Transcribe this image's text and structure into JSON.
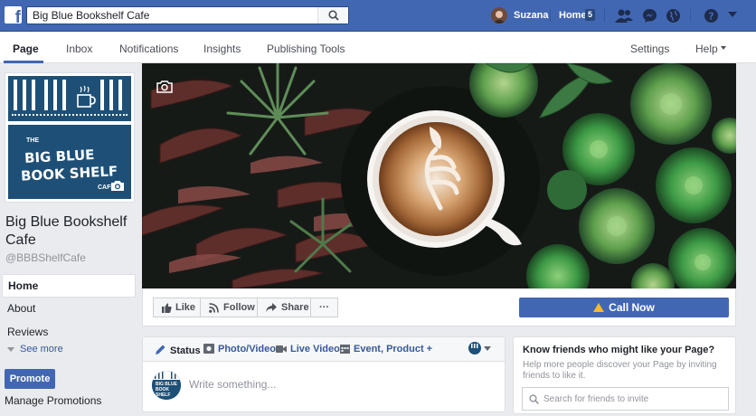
{
  "topbar": {
    "search_value": "Big Blue Bookshelf Cafe",
    "user_name": "Suzana",
    "home_label": "Home",
    "home_count": "5"
  },
  "subnav": {
    "tabs": [
      {
        "label": "Page",
        "active": true
      },
      {
        "label": "Inbox"
      },
      {
        "label": "Notifications"
      },
      {
        "label": "Insights"
      },
      {
        "label": "Publishing Tools"
      }
    ],
    "settings_label": "Settings",
    "help_label": "Help"
  },
  "profile": {
    "logo_the": "THE",
    "logo_line1": "BIG BLUE",
    "logo_line2": "BOOK SHELF",
    "logo_cafe": "CAFE",
    "page_name": "Big Blue Bookshelf Cafe",
    "handle": "@BBBShelfCafe"
  },
  "leftnav": {
    "items": [
      {
        "label": "Home",
        "active": true
      },
      {
        "label": "About"
      },
      {
        "label": "Reviews"
      }
    ],
    "see_more": "See more",
    "promote_label": "Promote",
    "manage_promotions": "Manage Promotions"
  },
  "actions": {
    "like": "Like",
    "follow": "Follow",
    "share": "Share",
    "more": "···",
    "call_now": "Call Now"
  },
  "composer": {
    "tabs": [
      "Status",
      "Photo/Video",
      "Live Video",
      "Event, Product +"
    ],
    "placeholder": "Write something...",
    "avatar_text": "BIG BLUE BOOK SHELF"
  },
  "invite": {
    "title": "Know friends who might like your Page?",
    "description": "Help more people discover your Page by inviting friends to like it.",
    "search_placeholder": "Search for friends to invite"
  },
  "colors": {
    "brand_blue": "#4267b2",
    "logo_navy": "#1e5077",
    "warning": "#f7b928"
  },
  "icons": [
    "facebook-logo-icon",
    "search-icon",
    "friends-icon",
    "messenger-icon",
    "globe-icon",
    "help-icon",
    "chevron-down-icon",
    "camera-icon",
    "like-icon",
    "rss-icon",
    "share-icon",
    "pencil-icon",
    "photo-icon",
    "video-icon",
    "event-icon",
    "warning-icon"
  ]
}
